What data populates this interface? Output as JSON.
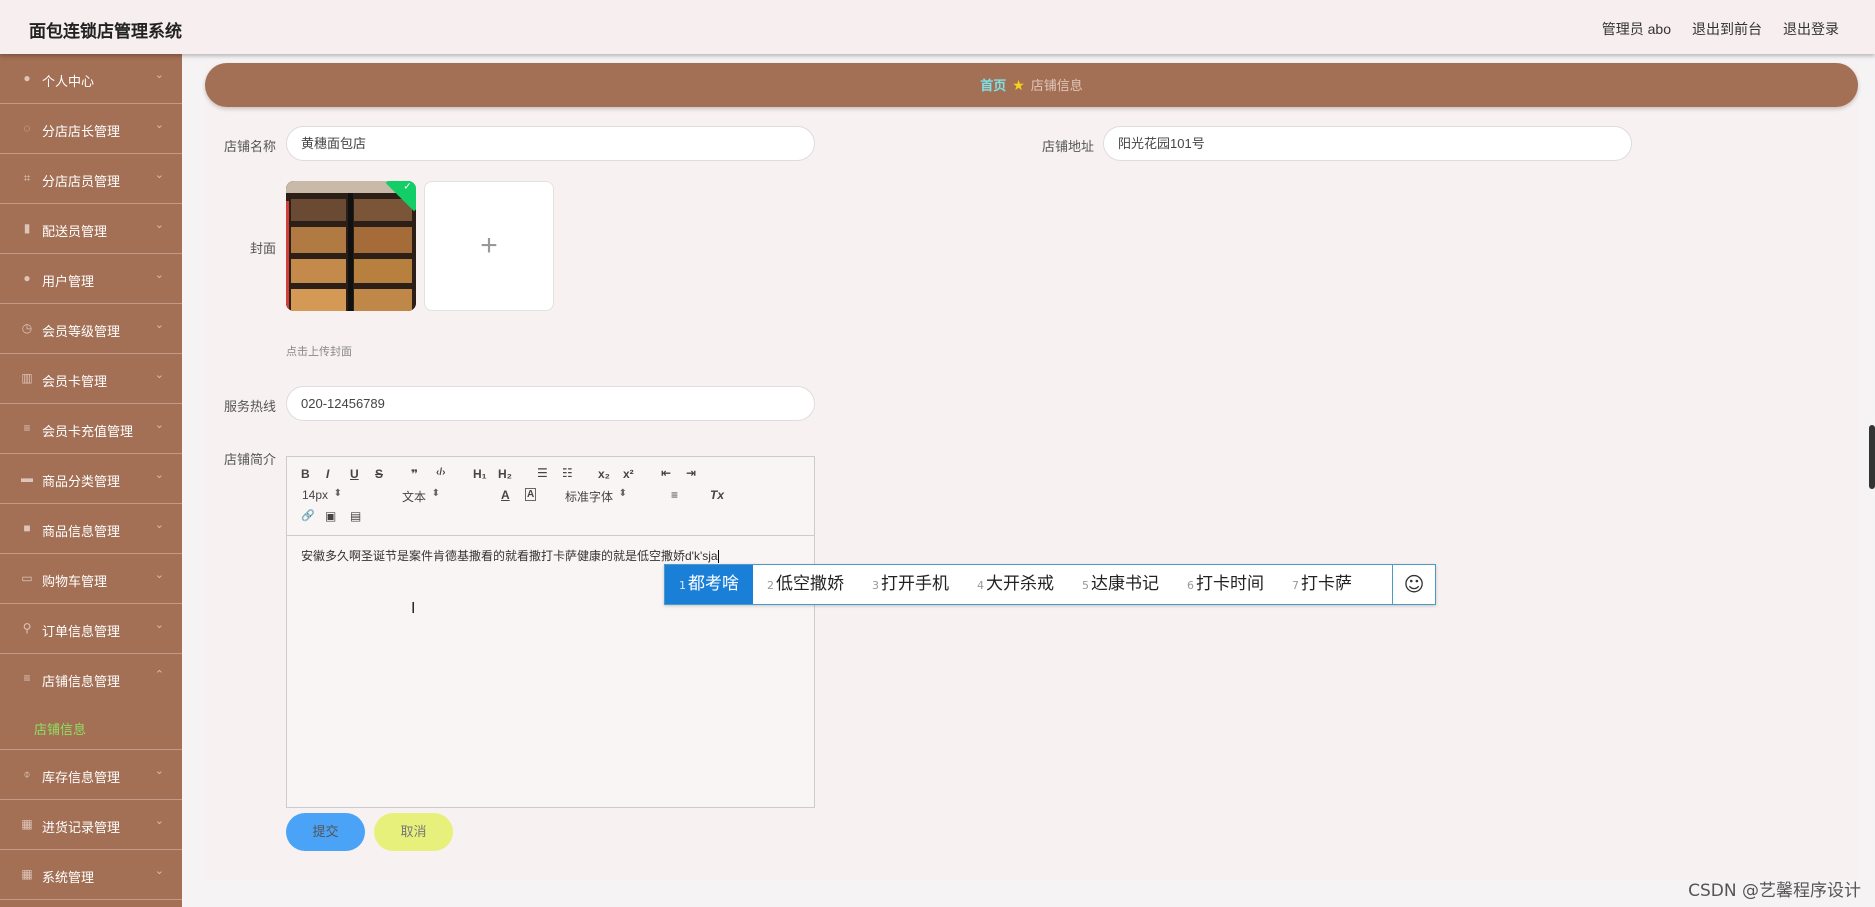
{
  "header": {
    "title": "面包连锁店管理系统",
    "user": "管理员 abo",
    "front_link": "退出到前台",
    "logout": "退出登录"
  },
  "sidebar": {
    "items": [
      {
        "label": "个人中心",
        "icon": "user-icon"
      },
      {
        "label": "分店店长管理",
        "icon": "compass-icon"
      },
      {
        "label": "分店店员管理",
        "icon": "crop-icon"
      },
      {
        "label": "配送员管理",
        "icon": "clipboard-icon"
      },
      {
        "label": "用户管理",
        "icon": "user-icon"
      },
      {
        "label": "会员等级管理",
        "icon": "clock-icon"
      },
      {
        "label": "会员卡管理",
        "icon": "chart-icon"
      },
      {
        "label": "会员卡充值管理",
        "icon": "list-icon"
      },
      {
        "label": "商品分类管理",
        "icon": "keyboard-icon"
      },
      {
        "label": "商品信息管理",
        "icon": "folder-icon"
      },
      {
        "label": "购物车管理",
        "icon": "monitor-icon"
      },
      {
        "label": "订单信息管理",
        "icon": "pin-icon"
      },
      {
        "label": "店铺信息管理",
        "icon": "list-icon"
      },
      {
        "label": "库存信息管理",
        "icon": "mic-icon"
      },
      {
        "label": "进货记录管理",
        "icon": "grid-icon"
      },
      {
        "label": "系统管理",
        "icon": "grid-icon"
      }
    ],
    "active_sub": "店铺信息"
  },
  "breadcrumb": {
    "home": "首页",
    "current": "店铺信息"
  },
  "form": {
    "shop_name_label": "店铺名称",
    "shop_name_value": "黄穗面包店",
    "address_label": "店铺地址",
    "address_value": "阳光花园101号",
    "cover_label": "封面",
    "upload_plus": "+",
    "upload_tip": "点击上传封面",
    "hotline_label": "服务热线",
    "hotline_value": "020-12456789",
    "intro_label": "店铺简介"
  },
  "editor": {
    "toolbar": {
      "bold": "B",
      "italic": "I",
      "underline": "U",
      "strike": "S",
      "quote": "❞",
      "code": "‹/›",
      "h1": "H₁",
      "h2": "H₂",
      "ol": "☰",
      "ul": "☷",
      "sub": "x₂",
      "sup": "x²",
      "outdent": "⇤",
      "indent": "⇥",
      "size": "14px",
      "header_select": "文本",
      "font_select": "标准字体",
      "color": "A",
      "bg": "A",
      "align": "≡",
      "clean": "Tx",
      "link": "🔗",
      "image": "▣",
      "video": "▤"
    },
    "content": "安徽多久啊圣诞节是案件肯德基撒看的就看撒打卡萨健康的就是低空撒娇d'k'sja"
  },
  "buttons": {
    "submit": "提交",
    "cancel": "取消"
  },
  "ime": {
    "candidates": [
      {
        "n": "1",
        "text": "都考啥"
      },
      {
        "n": "2",
        "text": "低空撒娇"
      },
      {
        "n": "3",
        "text": "打开手机"
      },
      {
        "n": "4",
        "text": "大开杀戒"
      },
      {
        "n": "5",
        "text": "达康书记"
      },
      {
        "n": "6",
        "text": "打卡时间"
      },
      {
        "n": "7",
        "text": "打卡萨"
      }
    ],
    "emoji": "☺"
  },
  "watermark": "CSDN @艺馨程序设计"
}
